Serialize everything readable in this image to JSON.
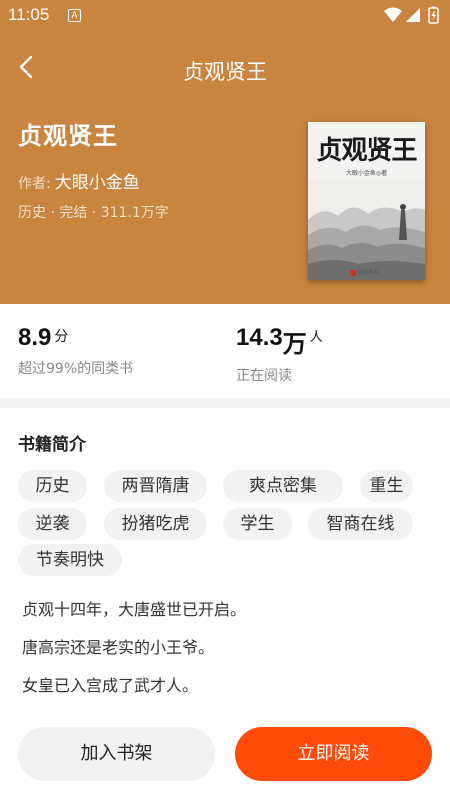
{
  "status_bar": {
    "time": "11:05",
    "notification_badge": "A",
    "icons": [
      "wifi-icon",
      "signal-icon",
      "battery-icon"
    ]
  },
  "nav": {
    "title": "贞观贤王",
    "back_icon": "chevron-left-icon"
  },
  "book": {
    "title": "贞观贤王",
    "author_label": "作者:",
    "author": "大眼小金鱼",
    "meta": "历史 · 完结 · 311.1万字",
    "cover": {
      "title": "贞观贤王",
      "author_line": "大眼小金鱼◎著",
      "publisher": "阅读传书"
    }
  },
  "stats": {
    "score": {
      "value": "8.9",
      "unit": "分",
      "label": "超过99%的同类书"
    },
    "readers": {
      "value": "14.3",
      "unit": "万",
      "suffix": "人",
      "label": "正在阅读"
    }
  },
  "intro": {
    "section_title": "书籍简介",
    "tags": [
      "历史",
      "两晋隋唐",
      "爽点密集",
      "重生",
      "逆袭",
      "扮猪吃虎",
      "学生",
      "智商在线",
      "节奏明快"
    ],
    "synopsis": [
      "贞观十四年，大唐盛世已开启。",
      "唐高宗还是老实的小王爷。",
      "女皇已入宫成了武才人。"
    ]
  },
  "actions": {
    "add_to_shelf": "加入书架",
    "read_now": "立即阅读"
  },
  "colors": {
    "header_bg": "#c9843f",
    "primary_button": "#ff4a0a",
    "tag_bg": "#f2f2f2"
  }
}
